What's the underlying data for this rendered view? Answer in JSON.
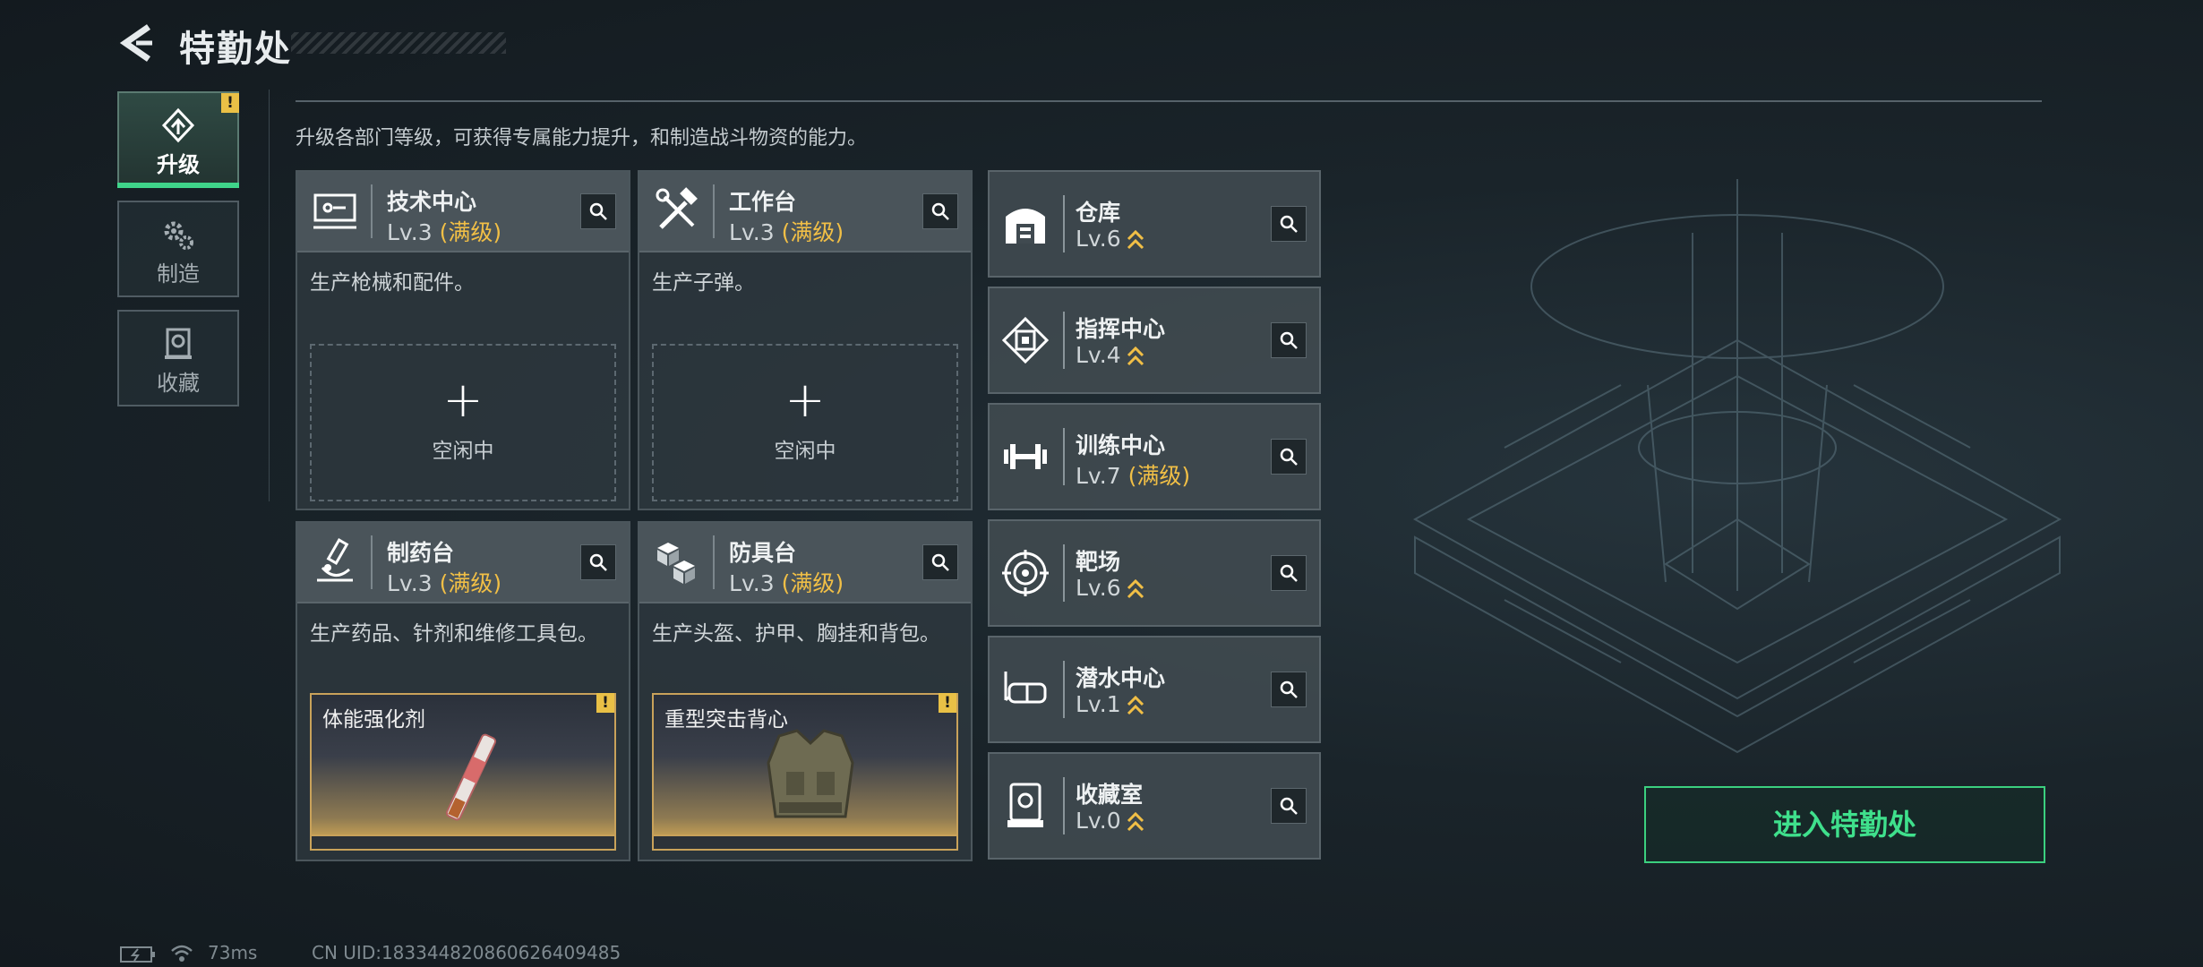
{
  "header": {
    "title": "特勤处"
  },
  "intro": "升级各部门等级，可获得专属能力提升，和制造战斗物资的能力。",
  "sidebar": {
    "tabs": [
      {
        "label": "升级",
        "icon": "upgrade-icon",
        "active": true,
        "alert": "!"
      },
      {
        "label": "制造",
        "icon": "gears-icon",
        "active": false
      },
      {
        "label": "收藏",
        "icon": "collection-icon",
        "active": false
      }
    ]
  },
  "cards": [
    {
      "name": "技术中心",
      "level": "Lv.3",
      "max": "(满级)",
      "desc": "生产枪械和配件。",
      "slot": "空闲中",
      "icon": "computer-icon"
    },
    {
      "name": "工作台",
      "level": "Lv.3",
      "max": "(满级)",
      "desc": "生产子弹。",
      "slot": "空闲中",
      "icon": "tools-icon"
    },
    {
      "name": "制药台",
      "level": "Lv.3",
      "max": "(满级)",
      "desc": "生产药品、针剂和维修工具包。",
      "item": "体能强化剂",
      "alert": "!",
      "icon": "microscope-icon"
    },
    {
      "name": "防具台",
      "level": "Lv.3",
      "max": "(满级)",
      "desc": "生产头盔、护甲、胸挂和背包。",
      "item": "重型突击背心",
      "alert": "!",
      "icon": "cubes-icon"
    }
  ],
  "slot_plus": "+",
  "list": [
    {
      "name": "仓库",
      "level": "Lv.6",
      "icon": "warehouse-icon"
    },
    {
      "name": "指挥中心",
      "level": "Lv.4",
      "icon": "command-center-icon"
    },
    {
      "name": "训练中心",
      "level": "Lv.7",
      "max": "(满级)",
      "icon": "dumbbell-icon"
    },
    {
      "name": "靶场",
      "level": "Lv.6",
      "icon": "target-icon"
    },
    {
      "name": "潜水中心",
      "level": "Lv.1",
      "icon": "diving-mask-icon"
    },
    {
      "name": "收藏室",
      "level": "Lv.0",
      "icon": "display-case-icon"
    }
  ],
  "enter_button": "进入特勤处",
  "footer": {
    "ping": "73ms",
    "uid": "CN UID:183344820860626409485"
  },
  "colors": {
    "accent": "#3fe08c",
    "max_level": "#f1bf46",
    "alert": "#e9c046"
  }
}
